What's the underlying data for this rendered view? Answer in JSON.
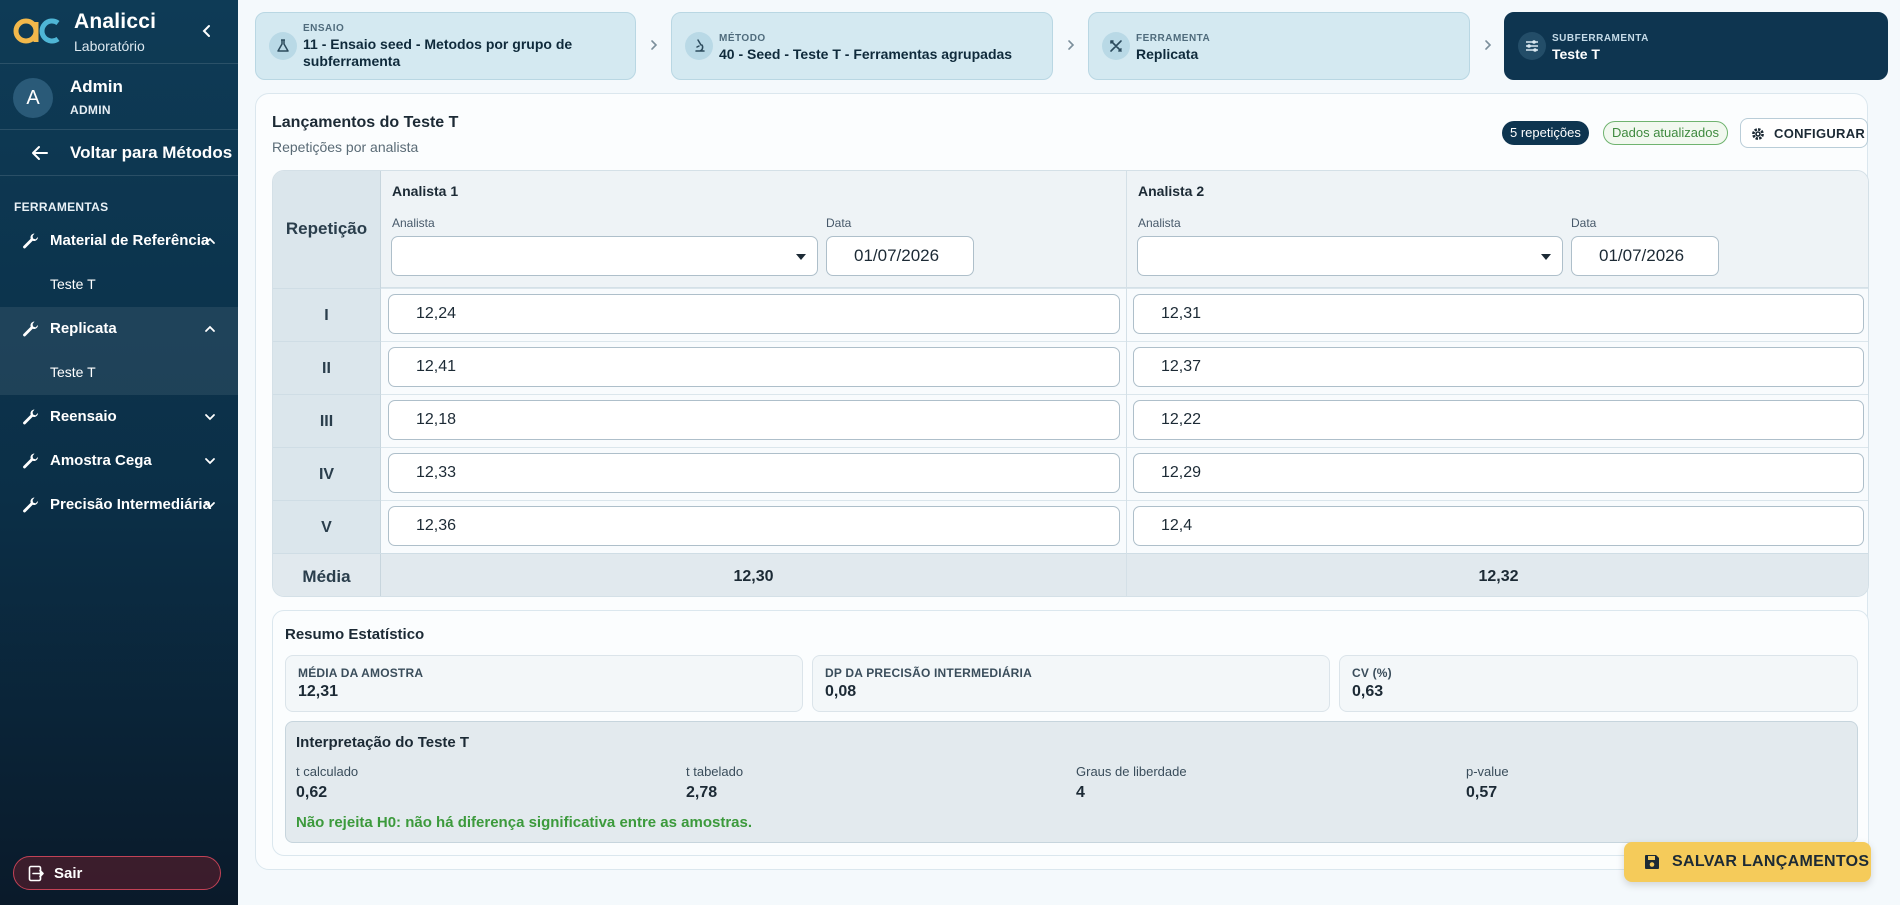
{
  "brand": {
    "name": "Analicci",
    "subtitle": "Laboratório"
  },
  "user": {
    "initial": "A",
    "name": "Admin",
    "role": "ADMIN"
  },
  "sidebar": {
    "back_label": "Voltar para Métodos",
    "section_title": "FERRAMENTAS",
    "items": [
      {
        "label": "Material de Referência",
        "expanded": true,
        "subitems": [
          "Teste T"
        ]
      },
      {
        "label": "Replicata",
        "expanded": true,
        "active": true,
        "subitems": [
          "Teste T"
        ]
      },
      {
        "label": "Reensaio",
        "expanded": false
      },
      {
        "label": "Amostra Cega",
        "expanded": false
      },
      {
        "label": "Precisão Intermediária",
        "expanded": false
      }
    ],
    "logout_label": "Sair"
  },
  "breadcrumb": [
    {
      "kicker": "ENSAIO",
      "value": "11 - Ensaio seed - Metodos por grupo de subferramenta",
      "icon": "flask-icon"
    },
    {
      "kicker": "MÉTODO",
      "value": "40 - Seed - Teste T - Ferramentas agrupadas",
      "icon": "microscope-icon"
    },
    {
      "kicker": "FERRAMENTA",
      "value": "Replicata",
      "icon": "tools-icon"
    },
    {
      "kicker": "SUBFERRAMENTA",
      "value": "Teste T",
      "icon": "sliders-icon",
      "current": true
    }
  ],
  "main": {
    "title": "Lançamentos do Teste T",
    "subtitle": "Repetições por analista",
    "repetitions_badge": "5 repetições",
    "status_badge": "Dados atualizados",
    "configure_label": "CONFIGURAR"
  },
  "grid": {
    "repetition_header": "Repetição",
    "analyst_field_label": "Analista",
    "date_field_label": "Data",
    "analysts": [
      {
        "name": "Analista 1",
        "selected_analyst": "",
        "date": "01/07/2026"
      },
      {
        "name": "Analista 2",
        "selected_analyst": "",
        "date": "01/07/2026"
      }
    ],
    "rows": [
      {
        "label": "I",
        "values": [
          "12,24",
          "12,31"
        ]
      },
      {
        "label": "II",
        "values": [
          "12,41",
          "12,37"
        ]
      },
      {
        "label": "III",
        "values": [
          "12,18",
          "12,22"
        ]
      },
      {
        "label": "IV",
        "values": [
          "12,33",
          "12,29"
        ]
      },
      {
        "label": "V",
        "values": [
          "12,36",
          "12,4"
        ]
      }
    ],
    "mean_label": "Média",
    "means": [
      "12,30",
      "12,32"
    ]
  },
  "stats": {
    "title": "Resumo Estatístico",
    "metrics": [
      {
        "label": "MÉDIA DA AMOSTRA",
        "value": "12,31"
      },
      {
        "label": "DP DA PRECISÃO INTERMEDIÁRIA",
        "value": "0,08"
      },
      {
        "label": "CV (%)",
        "value": "0,63"
      }
    ],
    "interpretation": {
      "title": "Interpretação do Teste T",
      "items": [
        {
          "label": "t calculado",
          "value": "0,62"
        },
        {
          "label": "t tabelado",
          "value": "2,78"
        },
        {
          "label": "Graus de liberdade",
          "value": "4"
        },
        {
          "label": "p-value",
          "value": "0,57"
        }
      ],
      "verdict": "Não rejeita H0: não há diferença significativa entre as amostras."
    }
  },
  "save_label": "SALVAR LANÇAMENTOS",
  "colors": {
    "sidebar": "#0e3b56",
    "accent": "#0e3550",
    "save": "#f5cb5a",
    "success": "#3c9a3c",
    "logout_border": "#c24256"
  }
}
